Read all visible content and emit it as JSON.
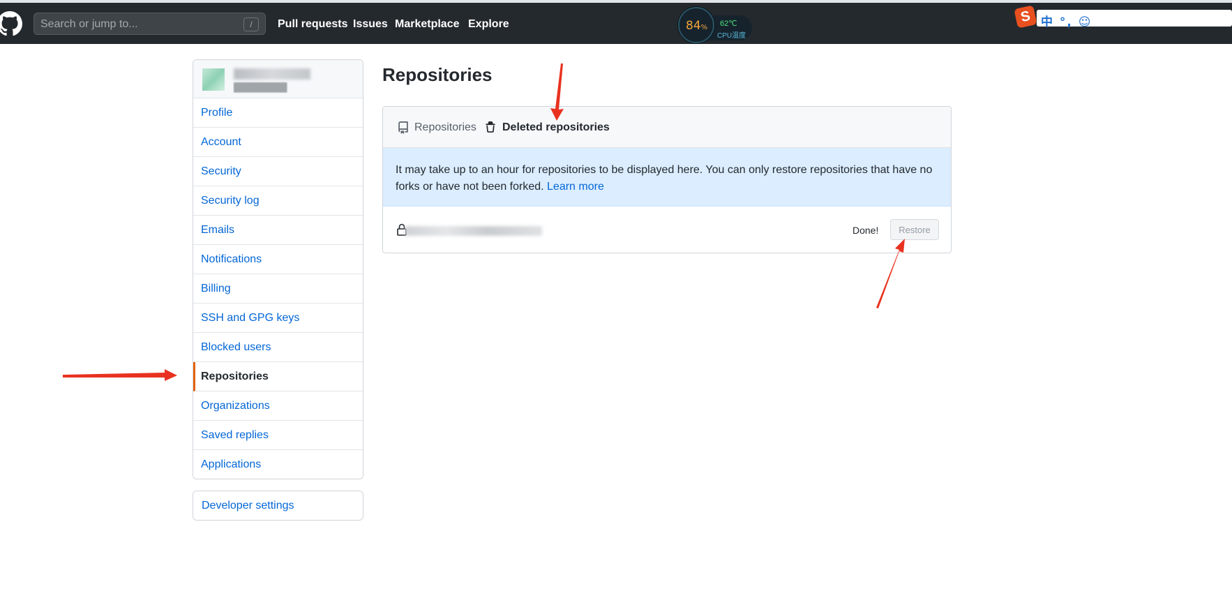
{
  "header": {
    "search": {
      "placeholder": "Search or jump to...",
      "shortcut": "/"
    },
    "nav": [
      {
        "label": "Pull requests"
      },
      {
        "label": "Issues"
      },
      {
        "label": "Marketplace"
      },
      {
        "label": "Explore"
      }
    ]
  },
  "overlays": {
    "cpu_widget": {
      "load": "84",
      "load_unit": "%",
      "temperature": "62℃",
      "label": "CPU温度"
    },
    "ime_toolbar": {
      "brand_icon": "sogou-s-icon",
      "text": "中 °, ☺"
    }
  },
  "sidebar": {
    "items": [
      {
        "label": "Profile"
      },
      {
        "label": "Account"
      },
      {
        "label": "Security"
      },
      {
        "label": "Security log"
      },
      {
        "label": "Emails"
      },
      {
        "label": "Notifications"
      },
      {
        "label": "Billing"
      },
      {
        "label": "SSH and GPG keys"
      },
      {
        "label": "Blocked users"
      },
      {
        "label": "Repositories",
        "selected": true
      },
      {
        "label": "Organizations"
      },
      {
        "label": "Saved replies"
      },
      {
        "label": "Applications"
      }
    ],
    "developer_settings": "Developer settings"
  },
  "main": {
    "title": "Repositories",
    "tabs": [
      {
        "label": "Repositories",
        "icon": "repo-icon",
        "active": false
      },
      {
        "label": "Deleted repositories",
        "icon": "trash-icon",
        "active": true
      }
    ],
    "notice": {
      "text": "It may take up to an hour for repositories to be displayed here. You can only restore repositories that have no forks or have not been forked.",
      "link": "Learn more"
    },
    "deleted_repo": {
      "status": "Done!",
      "button": "Restore"
    }
  },
  "colors": {
    "header_bg": "#24292e",
    "link": "#0366d6",
    "selected_indicator": "#e36209",
    "notice_bg": "#dbedff",
    "annotation_arrow": "#e8321f"
  }
}
